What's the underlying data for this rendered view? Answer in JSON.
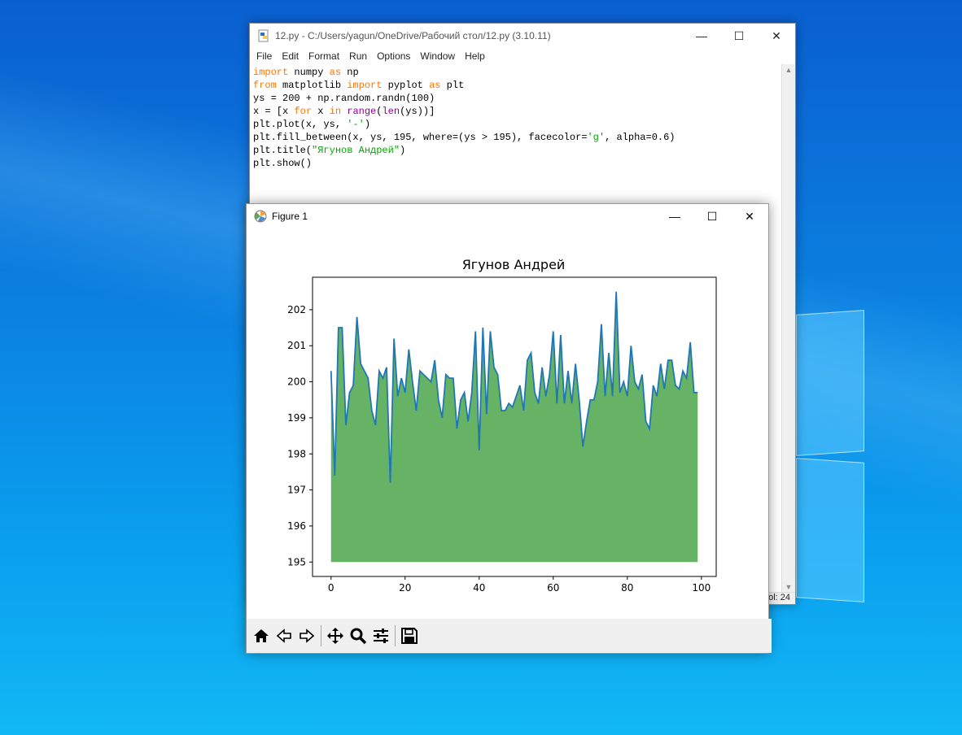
{
  "idle": {
    "title": "12.py - C:/Users/yagun/OneDrive/Рабочий стол/12.py (3.10.11)",
    "menu": [
      "File",
      "Edit",
      "Format",
      "Run",
      "Options",
      "Window",
      "Help"
    ],
    "code": [
      [
        {
          "t": "import",
          "c": "kw"
        },
        {
          "t": " numpy "
        },
        {
          "t": "as",
          "c": "kw"
        },
        {
          "t": " np"
        }
      ],
      [
        {
          "t": "from",
          "c": "kw"
        },
        {
          "t": " matplotlib "
        },
        {
          "t": "import",
          "c": "kw"
        },
        {
          "t": " pyplot "
        },
        {
          "t": "as",
          "c": "kw"
        },
        {
          "t": " plt"
        }
      ],
      [
        {
          "t": "ys = 200 + np.random.randn(100)"
        }
      ],
      [
        {
          "t": "x = [x "
        },
        {
          "t": "for",
          "c": "kw"
        },
        {
          "t": " x "
        },
        {
          "t": "in",
          "c": "kw"
        },
        {
          "t": " "
        },
        {
          "t": "range",
          "c": "bi"
        },
        {
          "t": "("
        },
        {
          "t": "len",
          "c": "bi"
        },
        {
          "t": "(ys))]"
        }
      ],
      [
        {
          "t": "plt.plot(x, ys, "
        },
        {
          "t": "'-'",
          "c": "st"
        },
        {
          "t": ")"
        }
      ],
      [
        {
          "t": "plt.fill_between(x, ys, 195, where=(ys > 195), facecolor="
        },
        {
          "t": "'g'",
          "c": "st"
        },
        {
          "t": ", alpha=0.6)"
        }
      ],
      [
        {
          "t": "plt.title("
        },
        {
          "t": "\"Ягунов Андрей\"",
          "c": "st"
        },
        {
          "t": ")"
        }
      ],
      [
        {
          "t": "plt.show()"
        }
      ]
    ],
    "status_col": "ol: 24"
  },
  "figure": {
    "title": "Figure 1",
    "toolbar": [
      "home-icon",
      "back-icon",
      "forward-icon",
      "pan-icon",
      "zoom-icon",
      "configure-subplots-icon",
      "save-icon"
    ]
  },
  "window_controls": {
    "minimize": "—",
    "maximize": "☐",
    "close": "✕"
  },
  "chart_data": {
    "type": "area",
    "title": "Ягунов Андрей",
    "xlabel": "",
    "ylabel": "",
    "xlim": [
      -5,
      104
    ],
    "ylim": [
      194.6,
      202.9
    ],
    "xticks": [
      0,
      20,
      40,
      60,
      80,
      100
    ],
    "yticks": [
      195,
      196,
      197,
      198,
      199,
      200,
      201,
      202
    ],
    "baseline": 195,
    "line_color": "#1f77b4",
    "fill_color": "#008000",
    "fill_alpha": 0.6,
    "grid": false,
    "x": [
      0,
      1,
      2,
      3,
      4,
      5,
      6,
      7,
      8,
      9,
      10,
      11,
      12,
      13,
      14,
      15,
      16,
      17,
      18,
      19,
      20,
      21,
      22,
      23,
      24,
      25,
      26,
      27,
      28,
      29,
      30,
      31,
      32,
      33,
      34,
      35,
      36,
      37,
      38,
      39,
      40,
      41,
      42,
      43,
      44,
      45,
      46,
      47,
      48,
      49,
      50,
      51,
      52,
      53,
      54,
      55,
      56,
      57,
      58,
      59,
      60,
      61,
      62,
      63,
      64,
      65,
      66,
      67,
      68,
      69,
      70,
      71,
      72,
      73,
      74,
      75,
      76,
      77,
      78,
      79,
      80,
      81,
      82,
      83,
      84,
      85,
      86,
      87,
      88,
      89,
      90,
      91,
      92,
      93,
      94,
      95,
      96,
      97,
      98,
      99
    ],
    "values": [
      200.3,
      197.4,
      201.5,
      201.5,
      198.8,
      199.7,
      199.9,
      201.8,
      200.5,
      200.3,
      200.1,
      199.2,
      198.8,
      200.3,
      200.1,
      200.4,
      197.2,
      201.2,
      199.6,
      200.1,
      199.7,
      200.9,
      200.0,
      199.2,
      200.3,
      200.2,
      200.1,
      200.0,
      200.6,
      199.5,
      199.0,
      200.2,
      200.1,
      200.1,
      198.7,
      199.5,
      199.7,
      198.9,
      199.7,
      201.4,
      198.1,
      201.5,
      199.1,
      201.4,
      200.4,
      200.2,
      199.2,
      199.2,
      199.4,
      199.3,
      199.6,
      199.9,
      199.2,
      200.6,
      200.8,
      199.7,
      199.4,
      200.4,
      199.6,
      200.2,
      201.4,
      199.4,
      201.3,
      199.4,
      200.3,
      199.4,
      200.5,
      199.5,
      198.2,
      198.9,
      199.5,
      199.5,
      200.0,
      201.6,
      199.6,
      200.8,
      199.6,
      202.5,
      199.7,
      200.0,
      199.6,
      201.0,
      200.0,
      199.8,
      200.2,
      198.9,
      198.7,
      199.9,
      199.6,
      200.5,
      199.8,
      200.6,
      200.6,
      199.9,
      199.8,
      200.3,
      200.1,
      201.1,
      199.7,
      199.7
    ]
  }
}
